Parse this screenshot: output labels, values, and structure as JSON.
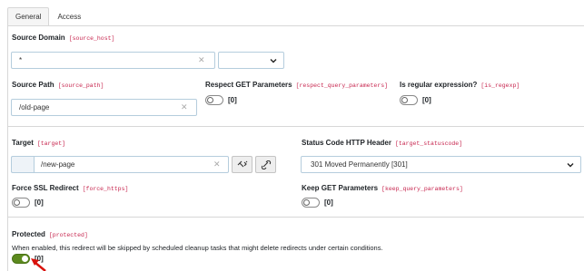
{
  "tabs": [
    {
      "label": "General",
      "active": true
    },
    {
      "label": "Access",
      "active": false
    }
  ],
  "source": {
    "domain": {
      "label": "Source Domain",
      "code": "[source_host]",
      "value": "*",
      "select_value": ""
    },
    "path": {
      "label": "Source Path",
      "code": "[source_path]",
      "value": "/old-page"
    },
    "respect_get": {
      "label": "Respect GET Parameters",
      "code": "[respect_query_parameters]",
      "value": "[0]",
      "on": false
    },
    "regex": {
      "label": "Is regular expression?",
      "code": "[is_regexp]",
      "value": "[0]",
      "on": false
    }
  },
  "target": {
    "target": {
      "label": "Target",
      "code": "[target]",
      "value": "/new-page"
    },
    "status": {
      "label": "Status Code HTTP Header",
      "code": "[target_statuscode]",
      "value": "301 Moved Permanently [301]"
    },
    "force_ssl": {
      "label": "Force SSL Redirect",
      "code": "[force_https]",
      "value": "[0]",
      "on": false
    },
    "keep_get": {
      "label": "Keep GET Parameters",
      "code": "[keep_query_parameters]",
      "value": "[0]",
      "on": false
    }
  },
  "protected": {
    "label": "Protected",
    "code": "[protected]",
    "description": "When enabled, this redirect will be skipped by scheduled cleanup tasks that might delete redirects under certain conditions.",
    "value": "[0]",
    "on": true
  },
  "icons": {
    "clear": "clear-icon",
    "chevron": "chevron-down-icon",
    "wizard": "wizard-icon",
    "link": "link-icon",
    "arrow": "red-arrow-pointer"
  },
  "colors": {
    "toggle_on": "#5c8a1e",
    "code_text": "#c7254e",
    "arrow": "#d9120c"
  }
}
